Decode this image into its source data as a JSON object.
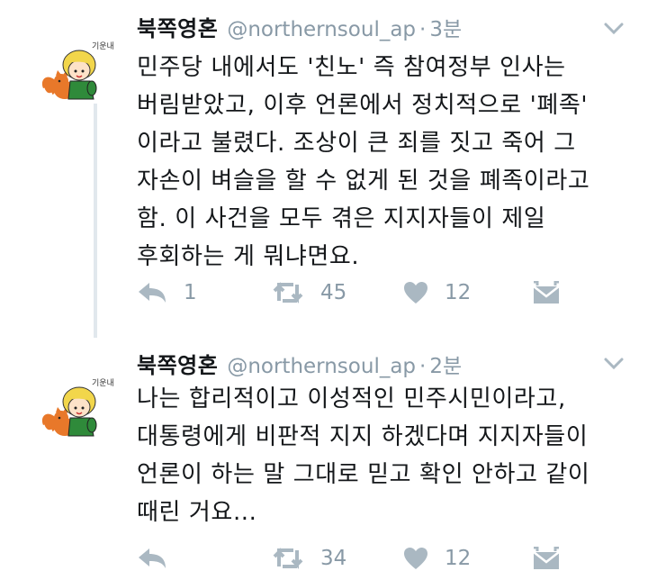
{
  "tweets": [
    {
      "author": {
        "name": "북쪽영혼",
        "handle": "@northernsoul_ap"
      },
      "separator": "·",
      "time": "3분",
      "lines": [
        "민주당 내에서도 '친노' 즉 참여정부 인사는",
        "버림받았고, 이후 언론에서 정치적으로 '폐족'",
        "이라고 불렸다. 조상이 큰 죄를 짓고 죽어 그",
        "자손이 벼슬을 할 수 없게 된 것을 폐족이라고",
        "함. 이 사건을 모두 겪은 지지자들이 제일",
        "후회하는 게 뭐냐면요."
      ],
      "actions": {
        "reply_count": "1",
        "retweet_count": "45",
        "like_count": "12"
      }
    },
    {
      "author": {
        "name": "북쪽영혼",
        "handle": "@northernsoul_ap"
      },
      "separator": "·",
      "time": "2분",
      "lines": [
        "나는 합리적이고 이성적인 민주시민이라고,",
        "대통령에게 비판적 지지 하겠다며 지지자들이",
        "언론이 하는 말 그대로 믿고 확인 안하고 같이",
        "때린 거요..."
      ],
      "actions": {
        "reply_count": "",
        "retweet_count": "34",
        "like_count": "12"
      }
    }
  ],
  "avatar_caption": "기운내",
  "icons": [
    "reply-icon",
    "retweet-icon",
    "like-icon",
    "direct-message-icon",
    "chevron-down-icon"
  ],
  "colors": {
    "text": "#14171a",
    "secondary": "#8899a6",
    "icon": "#aab8c2",
    "thread_line": "#e1e8ed"
  }
}
